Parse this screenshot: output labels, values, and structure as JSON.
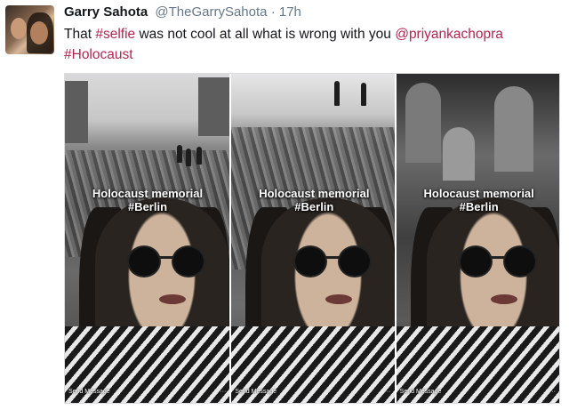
{
  "user": {
    "display_name": "Garry Sahota",
    "handle": "@TheGarrySahota",
    "separator": "·",
    "timestamp": "17h"
  },
  "tweet": {
    "text_parts": [
      "That ",
      "#selfie",
      " was not cool at all what is wrong with you ",
      "@priyankachopra",
      "#Holocaust"
    ]
  },
  "media": {
    "panels": [
      {
        "caption_line1": "Holocaust memorial",
        "caption_line2": "#Berlin",
        "footer_left": "Send Message",
        "footer_right": "···"
      },
      {
        "caption_line1": "Holocaust memorial",
        "caption_line2": "#Berlin",
        "footer_left": "Send Message",
        "footer_right": "···"
      },
      {
        "caption_line1": "Holocaust memorial",
        "caption_line2": "#Berlin",
        "footer_left": "Send Message",
        "footer_right": "···"
      }
    ]
  },
  "colors": {
    "link": "#b0264f",
    "meta": "#657786",
    "text": "#14171a"
  }
}
